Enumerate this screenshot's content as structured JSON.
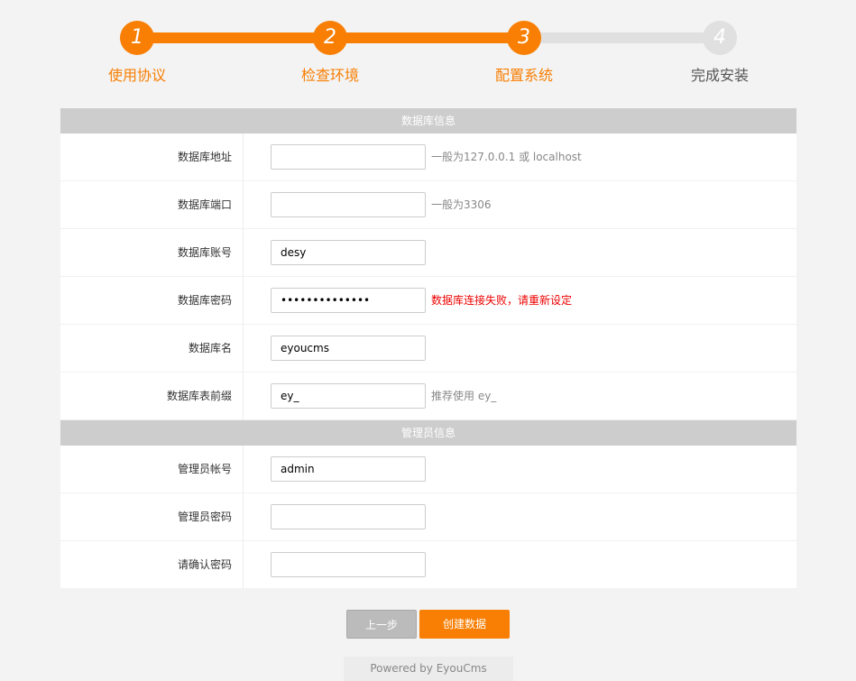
{
  "steps": [
    {
      "number": "1",
      "label": "使用协议",
      "status": "done"
    },
    {
      "number": "2",
      "label": "检查环境",
      "status": "done"
    },
    {
      "number": "3",
      "label": "配置系统",
      "status": "done"
    },
    {
      "number": "4",
      "label": "完成安装",
      "status": "todo"
    }
  ],
  "colors": {
    "accent": "#f87f04",
    "inactive": "#e0e0e0",
    "error": "#ee0000"
  },
  "db": {
    "title": "数据库信息",
    "host": {
      "label": "数据库地址",
      "value": "",
      "hint": "一般为127.0.0.1 或 localhost"
    },
    "port": {
      "label": "数据库端口",
      "value": "",
      "hint": "一般为3306"
    },
    "user": {
      "label": "数据库账号",
      "value": "desy"
    },
    "password": {
      "label": "数据库密码",
      "value": "••••••••••••••",
      "error": "数据库连接失败，请重新设定"
    },
    "name": {
      "label": "数据库名",
      "value": "eyoucms"
    },
    "prefix": {
      "label": "数据库表前缀",
      "value": "ey_",
      "hint": "推荐使用 ey_"
    }
  },
  "admin": {
    "title": "管理员信息",
    "account": {
      "label": "管理员帐号",
      "value": "admin"
    },
    "password": {
      "label": "管理员密码",
      "value": ""
    },
    "confirm": {
      "label": "请确认密码",
      "value": ""
    }
  },
  "buttons": {
    "prev": "上一步",
    "next": "创建数据"
  },
  "footer": "Powered by EyouCms"
}
